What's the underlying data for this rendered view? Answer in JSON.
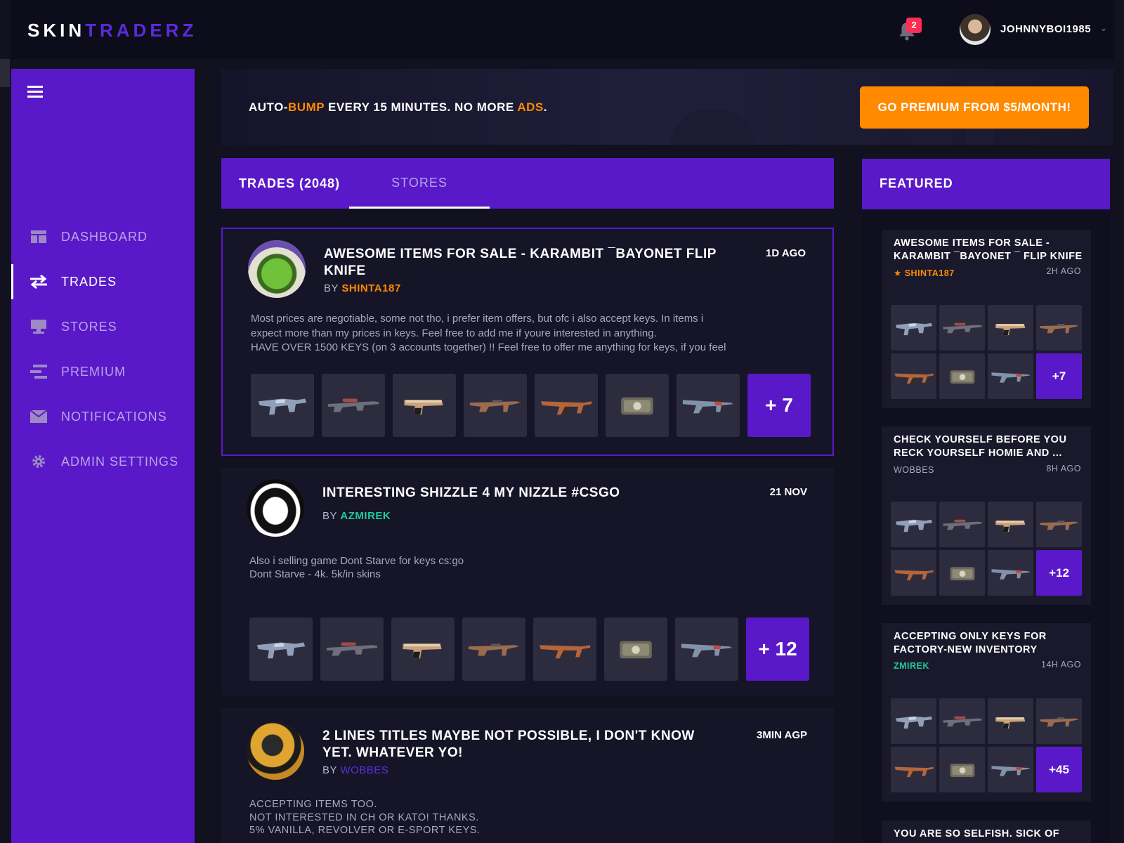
{
  "app": {
    "logo_part1": "SKIN",
    "logo_part2": "TRADERZ",
    "notification_count": "2",
    "username": "JOHNNYBOI1985",
    "accent_color": "#5a19c9",
    "highlight_color": "#ff8a00"
  },
  "sidebar": {
    "items": [
      {
        "label": "DASHBOARD",
        "icon": "dashboard-icon",
        "active": false
      },
      {
        "label": "TRADES",
        "icon": "swap-arrows-icon",
        "active": true
      },
      {
        "label": "STORES",
        "icon": "store-icon",
        "active": false
      },
      {
        "label": "PREMIUM",
        "icon": "premium-bars-icon",
        "active": false
      },
      {
        "label": "NOTIFICATIONS",
        "icon": "envelope-icon",
        "active": false
      },
      {
        "label": "ADMIN SETTINGS",
        "icon": "gear-icon",
        "active": false
      }
    ]
  },
  "banner": {
    "part1": "AUTO-",
    "part2": "BUMP",
    "part3": " EVERY 15 MINUTES. NO MORE ",
    "part4": "ADS",
    "part5": ".",
    "button": "GO PREMIUM FROM $5/MONTH!"
  },
  "tabs": [
    {
      "label": "TRADES (2048)",
      "active": true
    },
    {
      "label": "STORES",
      "active": false
    }
  ],
  "trades": [
    {
      "title": "AWESOME ITEMS FOR SALE - KARAMBIT ¯BAYONET FLIP KNIFE",
      "time": "1D AGO",
      "by": "BY",
      "author": "SHINTA187",
      "author_color": "#ff8a00",
      "description": "Most prices are negotiable, some not tho, i prefer item offers, but ofc i also accept keys. In items i\nexpect more than my prices in keys. Feel free to add me if youre interested in anything.\nHAVE OVER 1500 KEYS (on 3 accounts together) !! Feel free to offer me anything for keys, if you feel",
      "more": "+ 7",
      "items": [
        "smg-icon",
        "sniper-rifle-icon",
        "desert-eagle-icon",
        "rifle-icon",
        "ak47-icon",
        "weapon-case-icon",
        "m4-rifle-icon"
      ]
    },
    {
      "title": "INTERESTING SHIZZLE 4 MY NIZZLE #CSGO",
      "time": "21 NOV",
      "by": "BY",
      "author": "AZMIREK",
      "author_color": "#1fc99a",
      "description": "Also i selling game Dont Starve for keys cs:go\nDont Starve - 4k. 5k/in skins",
      "more": "+ 12",
      "items": [
        "smg-icon",
        "sniper-rifle-icon",
        "desert-eagle-icon",
        "rifle-icon",
        "ak47-icon",
        "weapon-case-icon",
        "m4-rifle-icon"
      ]
    },
    {
      "title": "2 LINES TITLES MAYBE NOT POSSIBLE, I DON'T KNOW YET. WHATEVER YO!",
      "time": "3MIN AGP",
      "by": "BY",
      "author": "WOBBES",
      "author_color": "#5a2fe0",
      "description": "ACCEPTING ITEMS TOO.\nNOT INTERESTED IN CH OR KATO! THANKS.\n5% VANILLA, REVOLVER OR E-SPORT KEYS."
    }
  ],
  "featured": {
    "title": "FEATURED",
    "cards": [
      {
        "title": "AWESOME ITEMS FOR SALE - KARAMBIT ¯BAYONET ¯ FLIP KNIFE",
        "author": "SHINTA187",
        "author_color": "#ff8a00",
        "star": "★",
        "time": "2H AGO",
        "more": "+7"
      },
      {
        "title": "CHECK YOURSELF BEFORE YOU RECK YOURSELF HOMIE AND ...",
        "author": "WOBBES",
        "author_color": "#a9a8ba",
        "time": "8H AGO",
        "more": "+12"
      },
      {
        "title": "ACCEPTING ONLY KEYS FOR FACTORY-NEW INVENTORY",
        "author": "ZMIREK",
        "author_color": "#1fc99a",
        "time": "14H AGO",
        "more": "+45"
      },
      {
        "title": "YOU ARE SO SELFISH. SICK OF YOUR BULLSHIT..."
      }
    ],
    "items": [
      "smg-icon",
      "sniper-rifle-icon",
      "desert-eagle-icon",
      "rifle-icon",
      "ak47-icon",
      "weapon-case-icon",
      "m4-rifle-icon"
    ]
  }
}
